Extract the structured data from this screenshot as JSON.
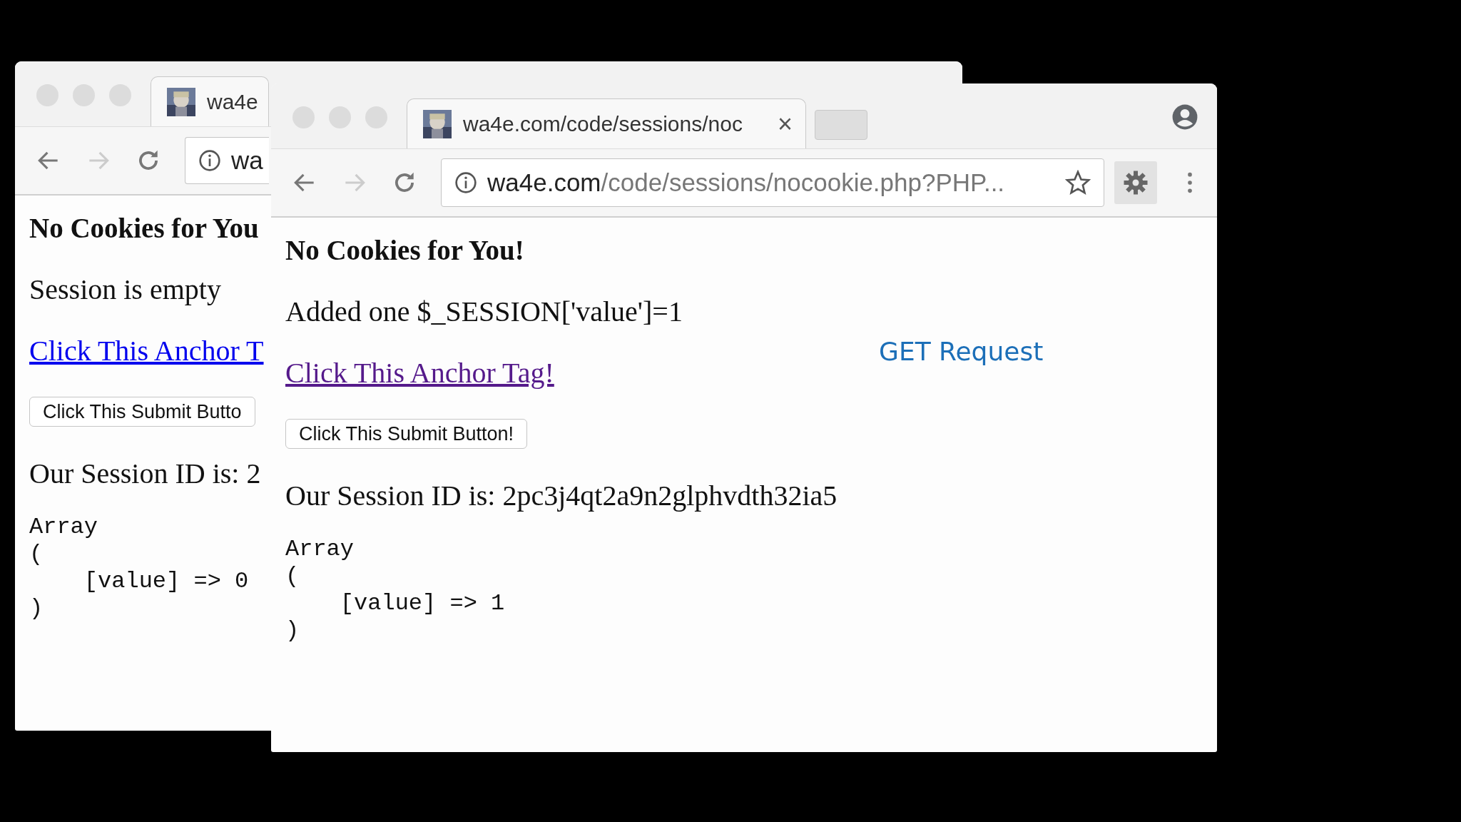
{
  "windows": [
    {
      "extras": false,
      "tab": {
        "title": "wa4e"
      },
      "url": {
        "host": "wa"
      },
      "page": {
        "heading": "No Cookies for You",
        "message": "Session is empty",
        "link": {
          "text": "Click This Anchor T",
          "visited": false
        },
        "button": "Click This Submit Butto",
        "session_id": "Our Session ID is: 2",
        "array_lines": [
          "Array",
          "(",
          "    [value] => 0",
          ")"
        ]
      }
    },
    {
      "extras": true,
      "tab": {
        "title": "wa4e.com/code/sessions/noc",
        "close": "×"
      },
      "url": {
        "host": "wa4e.com",
        "path": "/code/sessions/nocookie.php?PHP..."
      },
      "page": {
        "heading": "No Cookies for You!",
        "message": "Added one $_SESSION['value']=1",
        "link": {
          "text": "Click This Anchor Tag!",
          "visited": true
        },
        "button": "Click This Submit Button!",
        "session_id": "Our Session ID is: 2pc3j4qt2a9n2glphvdth32ia5",
        "array_lines": [
          "Array",
          "(",
          "    [value] => 1",
          ")"
        ]
      }
    }
  ],
  "annotation": "GET Request"
}
